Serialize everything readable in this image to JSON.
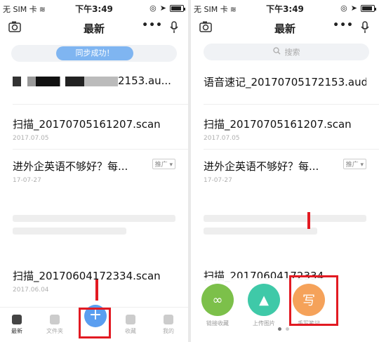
{
  "statusbar": {
    "carrier": "无 SIM 卡",
    "time": "下午3:49"
  },
  "left": {
    "title": "最新",
    "sync_label": "同步成功！",
    "items": [
      {
        "title": "2153.au...",
        "date": ""
      },
      {
        "title": "扫描_20170705161207.scan",
        "date": "2017.07.05"
      },
      {
        "title": "进外企英语不够好？每...",
        "date": "17-07-27",
        "tag": "推广"
      },
      {
        "title": "扫描_20170604172334.scan",
        "date": "2017.06.04"
      }
    ],
    "tabs": [
      {
        "label": "最新"
      },
      {
        "label": "文件夹"
      },
      {
        "label": "+"
      },
      {
        "label": "收藏"
      },
      {
        "label": "我的"
      }
    ]
  },
  "right": {
    "title": "最新",
    "search_placeholder": "搜索",
    "items": [
      {
        "title": "语音速记_20170705172153.aud",
        "date": ""
      },
      {
        "title": "扫描_20170705161207.scan",
        "date": "2017.07.05"
      },
      {
        "title": "进外企英语不够好？每...",
        "date": "17-07-27",
        "tag": "推广"
      },
      {
        "title": "扫描_20170604172334",
        "date": ""
      }
    ],
    "actions": [
      {
        "label": "链接收藏",
        "glyph": "∞",
        "color": "#7cc04a"
      },
      {
        "label": "上传图片",
        "glyph": "▲",
        "color": "#3fc9a8"
      },
      {
        "label": "手写笔记",
        "glyph": "写",
        "color": "#f5a25a"
      }
    ]
  },
  "colors": {
    "accent": "#5a9ef0",
    "highlight": "#e21a22"
  }
}
